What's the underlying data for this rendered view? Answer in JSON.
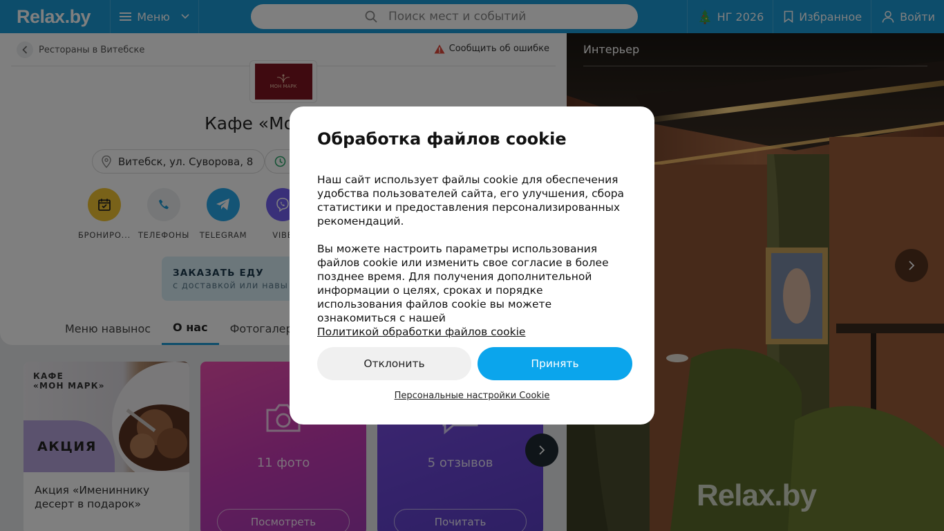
{
  "header": {
    "logo": "Relax",
    "logo_suffix": ".by",
    "menu_label": "Меню",
    "search_placeholder": "Поиск мест и событий",
    "ny_label": "НГ 2026",
    "favorites_label": "Избранное",
    "login_label": "Войти"
  },
  "breadcrumb": {
    "label": "Рестораны в Витебске"
  },
  "report_error": "Сообщить об ошибке",
  "venue": {
    "logo_text": "МОН МАРК",
    "title": "Кафе «Мо",
    "address": "Витебск, ул. Суворова, 8"
  },
  "actions": [
    {
      "label": "БРОНИРО...",
      "icon": "calendar-icon",
      "color": "#f2c533"
    },
    {
      "label": "ТЕЛЕФОНЫ",
      "icon": "phone-icon",
      "color": "#eef0f2"
    },
    {
      "label": "TELEGRAM",
      "icon": "telegram-icon",
      "color": "#29a9eb"
    },
    {
      "label": "VIBE",
      "icon": "viber-icon",
      "color": "#7360f2"
    }
  ],
  "order": {
    "title": "ЗАКАЗАТЬ ЕДУ",
    "subtitle": "с доставкой или навы"
  },
  "tabs": [
    {
      "label": "Меню навынос",
      "active": false
    },
    {
      "label": "О нас",
      "active": true
    },
    {
      "label": "Фотогалерея",
      "active": false
    }
  ],
  "cards": {
    "promo_top": "КАФЕ\n«МОН МАРК»",
    "promo_badge": "АКЦИЯ",
    "promo_text": "Акция «Имениннику десерт в подарок»",
    "photos_count": "11 фото",
    "photos_button": "Посмотреть",
    "reviews_count": "5 отзывов",
    "reviews_button": "Почитать"
  },
  "gallery": {
    "title": "Интерьер",
    "watermark": "Relax.by"
  },
  "cookie": {
    "title": "Обработка файлов cookie",
    "paragraph1": "Наш сайт использует файлы cookie для обеспечения удобства пользователей сайта, его улучшения, сбора статистики и предоставления персонализированных рекомендаций.",
    "paragraph2": "Вы можете настроить параметры использования файлов cookie или изменить свое согласие в более позднее время. Для получения дополнительной информации о целях, сроках и порядке использования файлов cookie вы можете ознакомиться с нашей",
    "policy_link": "Политикой обработки файлов cookie",
    "decline": "Отклонить",
    "accept": "Принять",
    "settings": "Персональные настройки Cookie"
  },
  "colors": {
    "brand": "#1b9ad6",
    "accept": "#0ba5ec"
  }
}
